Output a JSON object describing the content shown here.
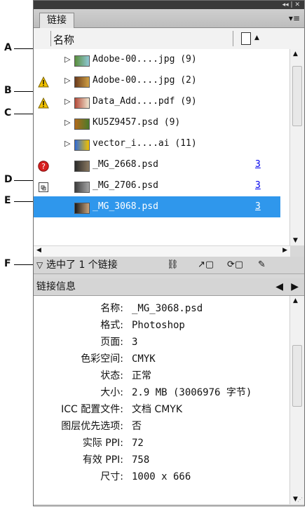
{
  "callouts": [
    "A",
    "B",
    "C",
    "D",
    "E",
    "F"
  ],
  "panel": {
    "tab_label": "链接",
    "menu_icon": "panel-menu-icon",
    "column_name_label": "名称"
  },
  "links": [
    {
      "name": "Adobe-00....jpg (9)",
      "status": "",
      "has_disclosure": true,
      "page": ""
    },
    {
      "name": "Adobe-00....jpg (2)",
      "status": "warning",
      "has_disclosure": true,
      "page": ""
    },
    {
      "name": "Data_Add....pdf (9)",
      "status": "warning",
      "has_disclosure": true,
      "page": ""
    },
    {
      "name": "KU5Z9457.psd (9)",
      "status": "",
      "has_disclosure": true,
      "page": ""
    },
    {
      "name": "vector_i....ai (11)",
      "status": "",
      "has_disclosure": true,
      "page": ""
    },
    {
      "name": "_MG_2668.psd",
      "status": "missing",
      "has_disclosure": false,
      "page": "3"
    },
    {
      "name": "_MG_2706.psd",
      "status": "embedded",
      "has_disclosure": false,
      "page": "3"
    },
    {
      "name": "_MG_3068.psd",
      "status": "",
      "has_disclosure": false,
      "page": "3",
      "selected": true
    }
  ],
  "status_bar": {
    "selection_text": "选中了 1 个链接"
  },
  "info": {
    "title": "链接信息",
    "rows": [
      {
        "label": "名称:",
        "value": "_MG_3068.psd"
      },
      {
        "label": "格式:",
        "value": "Photoshop"
      },
      {
        "label": "页面:",
        "value": "3"
      },
      {
        "label": "色彩空间:",
        "value": "CMYK"
      },
      {
        "label": "状态:",
        "value": "正常"
      },
      {
        "label": "大小:",
        "value": "2.9 MB (3006976 字节)"
      },
      {
        "label": "ICC 配置文件:",
        "value": "文档 CMYK"
      },
      {
        "label": "图层优先选项:",
        "value": "否"
      },
      {
        "label": "实际 PPI:",
        "value": "72"
      },
      {
        "label": "有效 PPI:",
        "value": "758"
      },
      {
        "label": "尺寸:",
        "value": "1000 x 666"
      }
    ]
  },
  "colors": {
    "selection": "#2f97ec",
    "warning": "#f2c200",
    "missing": "#d81f1f"
  }
}
